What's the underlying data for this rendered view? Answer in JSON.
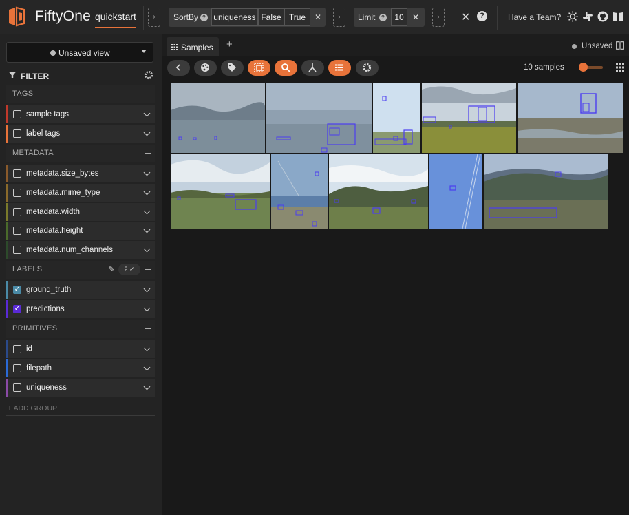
{
  "app": {
    "brand": "FiftyOne",
    "dataset": "quickstart",
    "have_team": "Have a Team?"
  },
  "stages": [
    {
      "name": "SortBy",
      "args": [
        "uniqueness",
        "False",
        "True"
      ]
    },
    {
      "name": "Limit",
      "args": [
        "10"
      ]
    }
  ],
  "icons": {
    "logo": "fiftyone-logo-icon",
    "theme": "sun-icon",
    "slack": "slack-icon",
    "github": "github-icon",
    "docs": "book-icon"
  },
  "sidebar": {
    "view_select": "Unsaved view",
    "filter_label": "FILTER",
    "groups": {
      "tags": "TAGS",
      "metadata": "METADATA",
      "labels": "LABELS",
      "primitives": "PRIMITIVES"
    },
    "labels_count": "2 ✓",
    "tags": [
      {
        "label": "sample tags",
        "color": "#c0392b",
        "checked": false
      },
      {
        "label": "label tags",
        "color": "#e8733a",
        "checked": false
      }
    ],
    "metadata": [
      {
        "label": "metadata.size_bytes",
        "color": "#8a5a2b",
        "checked": false
      },
      {
        "label": "metadata.mime_type",
        "color": "#8a6a2b",
        "checked": false
      },
      {
        "label": "metadata.width",
        "color": "#7a7a2b",
        "checked": false
      },
      {
        "label": "metadata.height",
        "color": "#4a6a2b",
        "checked": false
      },
      {
        "label": "metadata.num_channels",
        "color": "#2d4a2b",
        "checked": false
      }
    ],
    "labels": [
      {
        "label": "ground_truth",
        "color": "#4a8aa6",
        "checked": true
      },
      {
        "label": "predictions",
        "color": "#5a2ad6",
        "checked": true
      }
    ],
    "primitives": [
      {
        "label": "id",
        "color": "#2b4a8a",
        "checked": false
      },
      {
        "label": "filepath",
        "color": "#2b6ad6",
        "checked": false
      },
      {
        "label": "uniqueness",
        "color": "#8a4aa6",
        "checked": false
      }
    ],
    "add_group": "+ ADD GROUP"
  },
  "main": {
    "tab_label": "Samples",
    "add_tab": "+",
    "unsaved": "Unsaved",
    "samples_count": "10 samples",
    "zoom_level": 0.1,
    "toolbar": [
      "back-icon",
      "palette-icon",
      "tag-icon",
      "patches-icon",
      "similarity-search-icon",
      "sort-by-similarity-icon",
      "list-view-icon",
      "settings-icon"
    ]
  },
  "colors": {
    "accent": "#e8733a",
    "box": "#4b3df0"
  }
}
